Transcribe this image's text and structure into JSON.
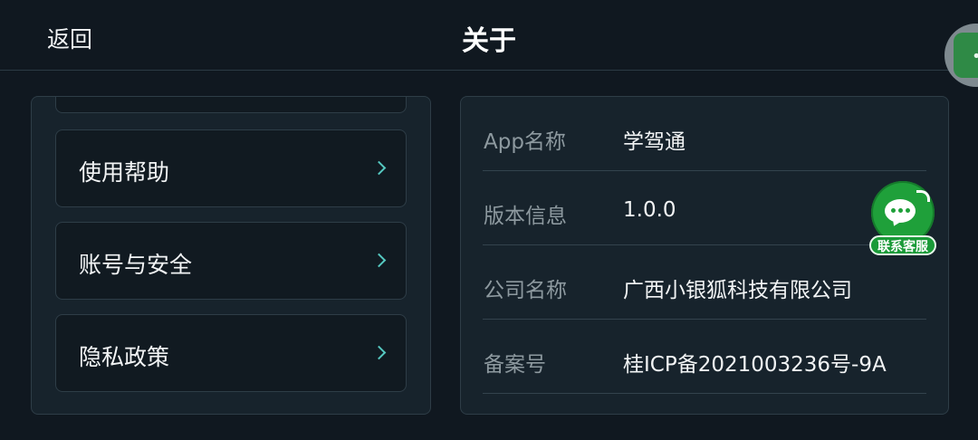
{
  "header": {
    "back_label": "返回",
    "title": "关于",
    "more_icon": "more-dots-icon",
    "more_text": "••"
  },
  "menu": {
    "items": [
      {
        "label": "使用帮助",
        "icon": "chevron-right-icon"
      },
      {
        "label": "账号与安全",
        "icon": "chevron-right-icon"
      },
      {
        "label": "隐私政策",
        "icon": "chevron-right-icon"
      }
    ]
  },
  "info": {
    "rows": [
      {
        "key": "App名称",
        "value": "学驾通"
      },
      {
        "key": "版本信息",
        "value": "1.0.0"
      },
      {
        "key": "公司名称",
        "value": "广西小银狐科技有限公司"
      },
      {
        "key": "备案号",
        "value": "桂ICP备2021003236号-9A"
      }
    ]
  },
  "customer_service": {
    "label": "联系客服",
    "icon": "chat-bubble-icon"
  },
  "colors": {
    "background": "#101820",
    "panel": "#17232c",
    "accent_chevron": "#55c8c0",
    "service_green": "#1fa03a"
  }
}
